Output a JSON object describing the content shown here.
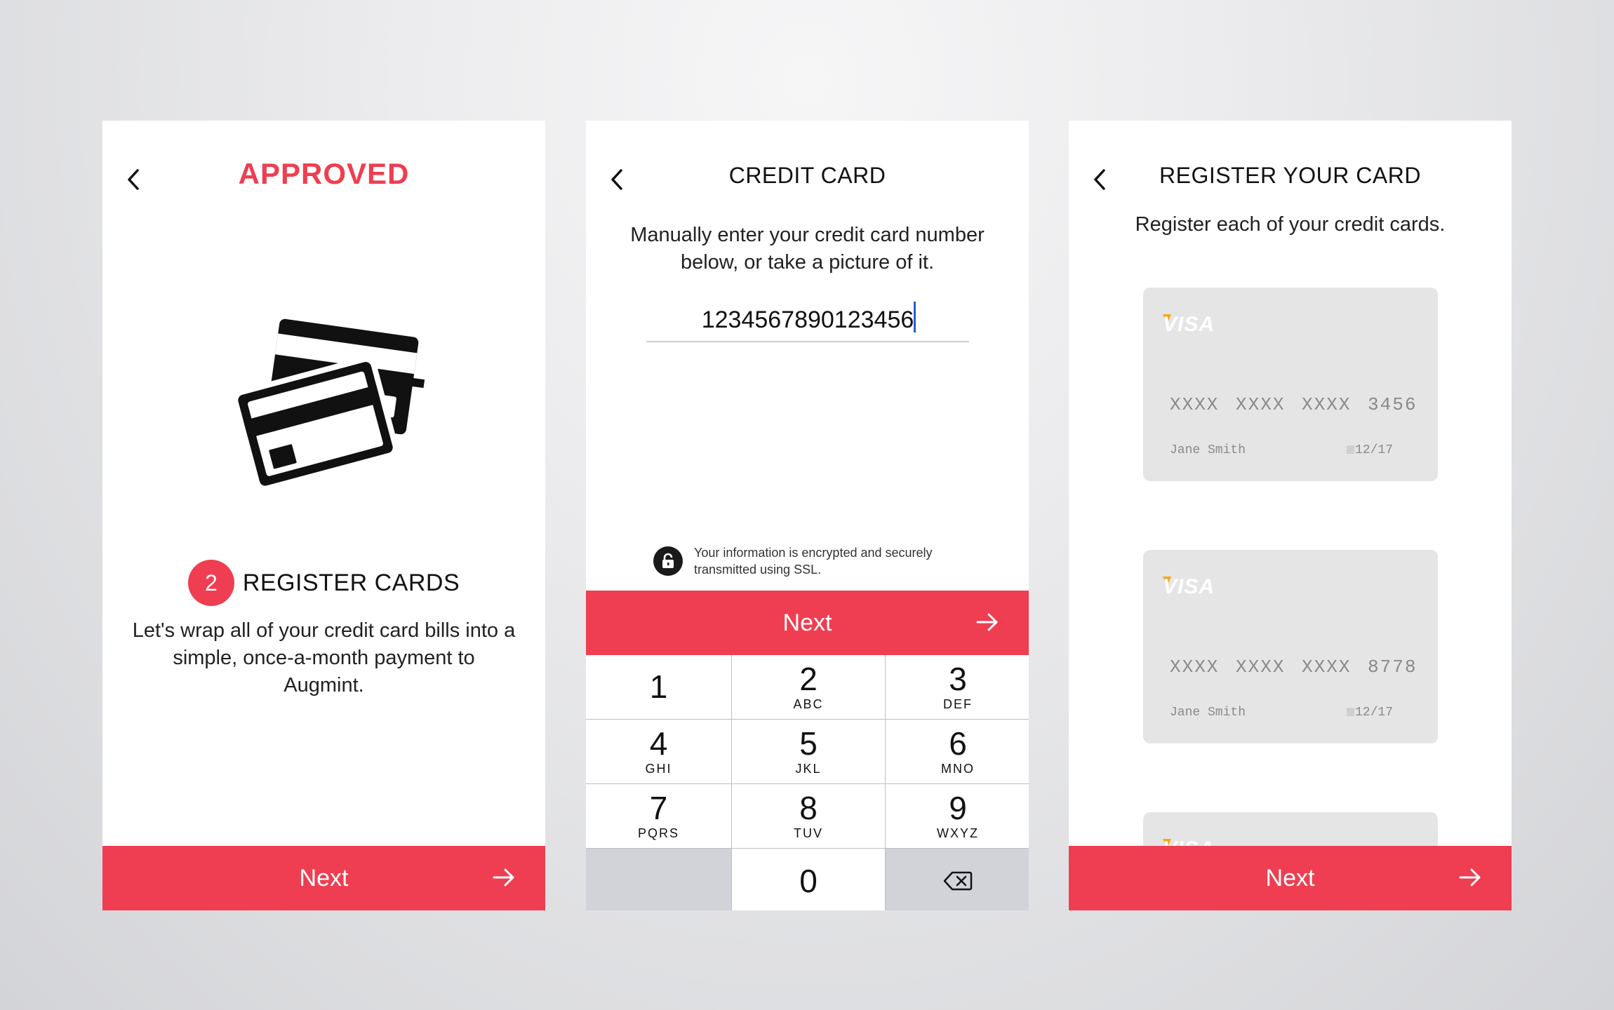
{
  "colors": {
    "accent": "#ef3e51",
    "card_bg": "#e5e5e6",
    "caret": "#2a5bd7"
  },
  "screen1": {
    "back_icon": "chevron-left-icon",
    "title": "APPROVED",
    "illustration_icon": "credit-cards-icon",
    "step_number": "2",
    "step_label": "REGISTER CARDS",
    "body": "Let's wrap all of your credit card bills into a simple, once-a-month payment to Augmint.",
    "next_label": "Next",
    "next_icon": "arrow-right-icon"
  },
  "screen2": {
    "back_icon": "chevron-left-icon",
    "title": "CREDIT CARD",
    "instructions": "Manually enter your credit card number below, or take a picture of it.",
    "card_number_value": "1234567890123456",
    "secure_icon": "lock-icon",
    "secure_text": "Your information is encrypted and securely transmitted using SSL.",
    "next_label": "Next",
    "next_icon": "arrow-right-icon",
    "keypad": [
      {
        "digit": "1",
        "letters": ""
      },
      {
        "digit": "2",
        "letters": "ABC"
      },
      {
        "digit": "3",
        "letters": "DEF"
      },
      {
        "digit": "4",
        "letters": "GHI"
      },
      {
        "digit": "5",
        "letters": "JKL"
      },
      {
        "digit": "6",
        "letters": "MNO"
      },
      {
        "digit": "7",
        "letters": "PQRS"
      },
      {
        "digit": "8",
        "letters": "TUV"
      },
      {
        "digit": "9",
        "letters": "WXYZ"
      },
      {
        "digit": "0",
        "letters": ""
      }
    ],
    "delete_icon": "backspace-icon"
  },
  "screen3": {
    "back_icon": "chevron-left-icon",
    "title": "REGISTER YOUR CARD",
    "subtitle": "Register each of your credit cards.",
    "cards": [
      {
        "brand": "VISA",
        "number": "XXXX XXXX XXXX 3456",
        "holder": "Jane Smith",
        "expiry": "12/17"
      },
      {
        "brand": "VISA",
        "number": "XXXX XXXX XXXX 8778",
        "holder": "Jane Smith",
        "expiry": "12/17"
      },
      {
        "brand": "VISA"
      }
    ],
    "next_label": "Next",
    "next_icon": "arrow-right-icon"
  }
}
